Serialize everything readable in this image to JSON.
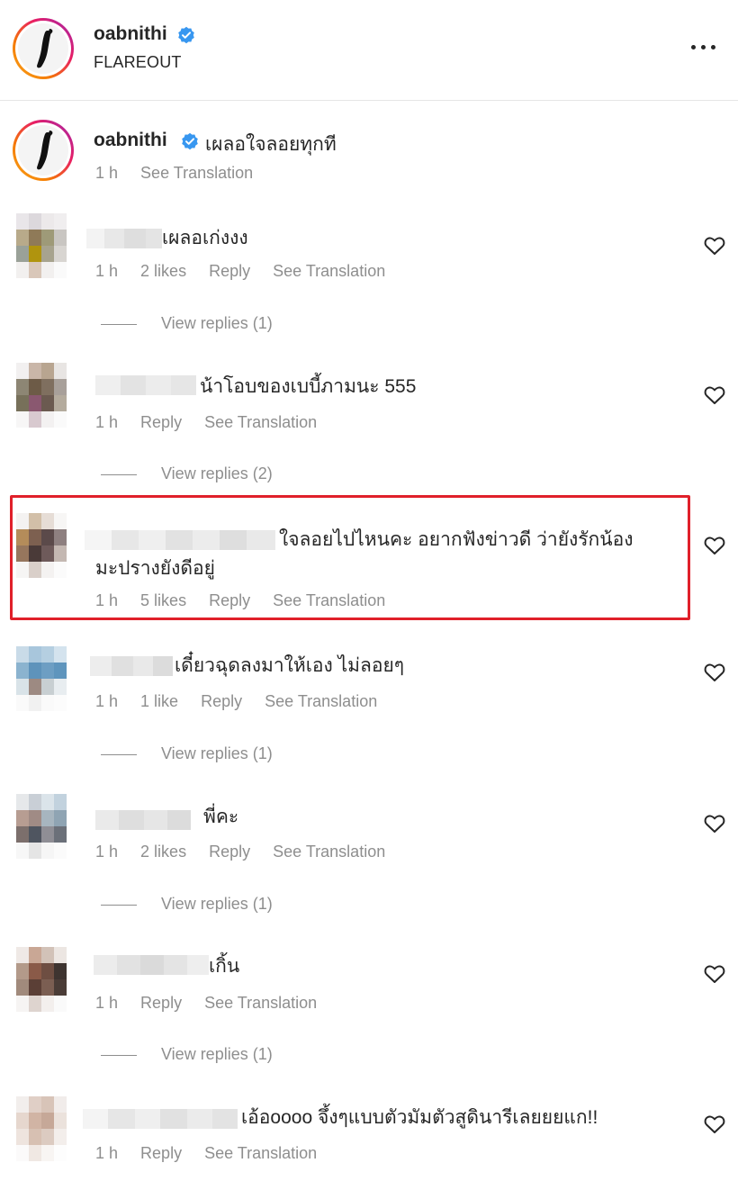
{
  "post": {
    "username": "oabnithi",
    "location": "FLAREOUT"
  },
  "caption": {
    "username": "oabnithi",
    "text": "เผลอใจลอยทุกที",
    "time": "1 h",
    "see_translation": "See Translation"
  },
  "comments": [
    {
      "text": "เผลอเก่งงง",
      "time": "1 h",
      "likes": "2 likes",
      "reply": "Reply",
      "see_translation": "See Translation",
      "view_replies": "View replies (1)"
    },
    {
      "text": "น้าโอบของเบบี้ภามนะ 555",
      "time": "1 h",
      "likes": "",
      "reply": "Reply",
      "see_translation": "See Translation",
      "view_replies": "View replies (2)"
    },
    {
      "text": "ใจลอยไปไหนคะ อยากฟังข่าวดี ว่ายังรักน้อง",
      "text_line2": "มะปรางยังดีอยู่",
      "time": "1 h",
      "likes": "5 likes",
      "reply": "Reply",
      "see_translation": "See Translation",
      "view_replies": ""
    },
    {
      "text": "เดี๋ยวฉุดลงมาให้เอง ไม่ลอยๆ",
      "time": "1 h",
      "likes": "1 like",
      "reply": "Reply",
      "see_translation": "See Translation",
      "view_replies": "View replies (1)"
    },
    {
      "text": "พี่คะ",
      "time": "1 h",
      "likes": "2 likes",
      "reply": "Reply",
      "see_translation": "See Translation",
      "view_replies": "View replies (1)"
    },
    {
      "text": "เกิ้น",
      "time": "1 h",
      "likes": "",
      "reply": "Reply",
      "see_translation": "See Translation",
      "view_replies": "View replies (1)"
    },
    {
      "text": "เอ้อoooo จึ้งๆแบบตัวมัมตัวสูดินารีเลยยยแก!!",
      "time": "1 h",
      "likes": "",
      "reply": "Reply",
      "see_translation": "See Translation",
      "view_replies": ""
    }
  ],
  "colors": {
    "verified": "#3897f0",
    "highlight": "#e0202a",
    "meta": "#8e8e8e"
  },
  "icons": [
    "verified-badge-icon",
    "more-options-icon",
    "heart-icon"
  ]
}
